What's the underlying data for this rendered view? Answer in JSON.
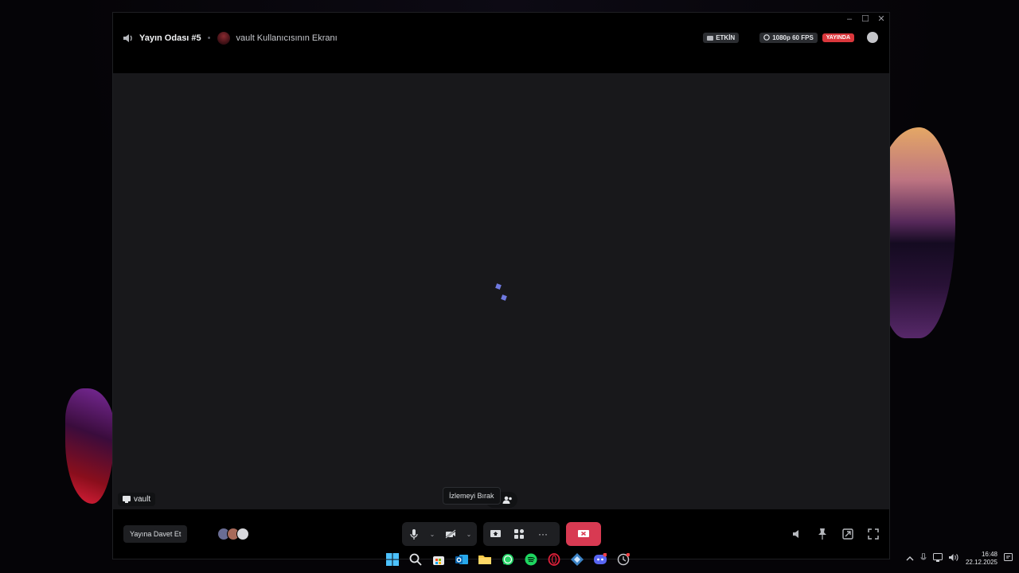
{
  "window": {
    "controls": [
      "minimize",
      "maximize",
      "close"
    ]
  },
  "header": {
    "room_name": "Yayın Odası #5",
    "separator": "•",
    "screen_title": "vault Kullanıcısının Ekranı",
    "activity_badge": "ETKİN",
    "quality_badge": "1080p 60 FPS",
    "live_badge": "YAYINDA"
  },
  "stage": {
    "streamer_name": "vault",
    "loading_color": "#6f79e0"
  },
  "controls": {
    "invite_label": "Yayına Davet Et",
    "stop_tooltip": "İzlemeyi Bırak",
    "stop_color": "#d83a52"
  },
  "taskbar": {
    "apps": [
      "windows-start",
      "search",
      "store",
      "outlook",
      "file-explorer",
      "whatsapp",
      "spotify",
      "opera-gx",
      "app",
      "discord",
      "clock-app"
    ]
  },
  "tray": {
    "time": "16:48",
    "date": "22.12.2025"
  }
}
